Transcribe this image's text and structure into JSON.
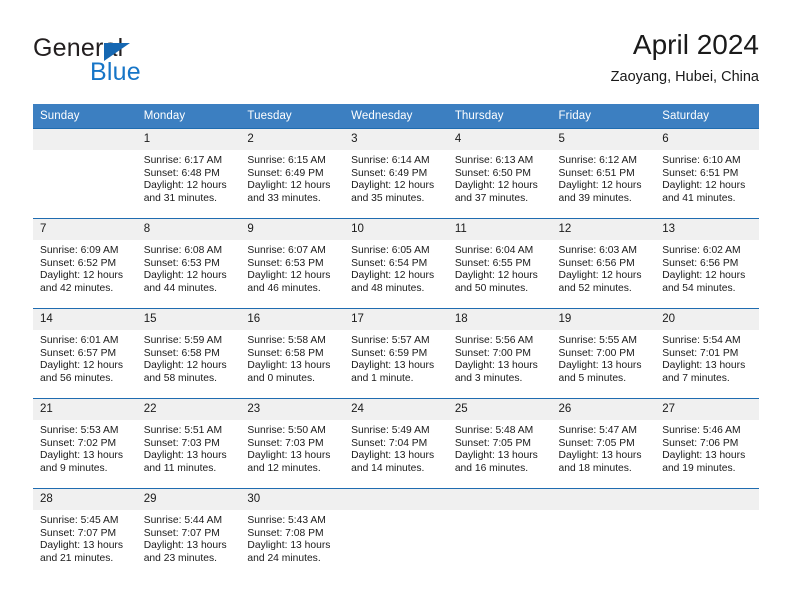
{
  "brand": {
    "name_part1": "General",
    "name_part2": "Blue",
    "accent_color": "#1675c7",
    "triangle_color": "#1567b2"
  },
  "header": {
    "title": "April 2024",
    "subtitle": "Zaoyang, Hubei, China",
    "header_bg": "#3c7fc1",
    "row_border": "#1f6cb0",
    "daynum_bg": "#f0f0f0"
  },
  "weekdays": [
    "Sunday",
    "Monday",
    "Tuesday",
    "Wednesday",
    "Thursday",
    "Friday",
    "Saturday"
  ],
  "weeks": [
    [
      {
        "day": "",
        "sunrise": "",
        "sunset": "",
        "daylight1": "",
        "daylight2": ""
      },
      {
        "day": "1",
        "sunrise": "Sunrise: 6:17 AM",
        "sunset": "Sunset: 6:48 PM",
        "daylight1": "Daylight: 12 hours",
        "daylight2": "and 31 minutes."
      },
      {
        "day": "2",
        "sunrise": "Sunrise: 6:15 AM",
        "sunset": "Sunset: 6:49 PM",
        "daylight1": "Daylight: 12 hours",
        "daylight2": "and 33 minutes."
      },
      {
        "day": "3",
        "sunrise": "Sunrise: 6:14 AM",
        "sunset": "Sunset: 6:49 PM",
        "daylight1": "Daylight: 12 hours",
        "daylight2": "and 35 minutes."
      },
      {
        "day": "4",
        "sunrise": "Sunrise: 6:13 AM",
        "sunset": "Sunset: 6:50 PM",
        "daylight1": "Daylight: 12 hours",
        "daylight2": "and 37 minutes."
      },
      {
        "day": "5",
        "sunrise": "Sunrise: 6:12 AM",
        "sunset": "Sunset: 6:51 PM",
        "daylight1": "Daylight: 12 hours",
        "daylight2": "and 39 minutes."
      },
      {
        "day": "6",
        "sunrise": "Sunrise: 6:10 AM",
        "sunset": "Sunset: 6:51 PM",
        "daylight1": "Daylight: 12 hours",
        "daylight2": "and 41 minutes."
      }
    ],
    [
      {
        "day": "7",
        "sunrise": "Sunrise: 6:09 AM",
        "sunset": "Sunset: 6:52 PM",
        "daylight1": "Daylight: 12 hours",
        "daylight2": "and 42 minutes."
      },
      {
        "day": "8",
        "sunrise": "Sunrise: 6:08 AM",
        "sunset": "Sunset: 6:53 PM",
        "daylight1": "Daylight: 12 hours",
        "daylight2": "and 44 minutes."
      },
      {
        "day": "9",
        "sunrise": "Sunrise: 6:07 AM",
        "sunset": "Sunset: 6:53 PM",
        "daylight1": "Daylight: 12 hours",
        "daylight2": "and 46 minutes."
      },
      {
        "day": "10",
        "sunrise": "Sunrise: 6:05 AM",
        "sunset": "Sunset: 6:54 PM",
        "daylight1": "Daylight: 12 hours",
        "daylight2": "and 48 minutes."
      },
      {
        "day": "11",
        "sunrise": "Sunrise: 6:04 AM",
        "sunset": "Sunset: 6:55 PM",
        "daylight1": "Daylight: 12 hours",
        "daylight2": "and 50 minutes."
      },
      {
        "day": "12",
        "sunrise": "Sunrise: 6:03 AM",
        "sunset": "Sunset: 6:56 PM",
        "daylight1": "Daylight: 12 hours",
        "daylight2": "and 52 minutes."
      },
      {
        "day": "13",
        "sunrise": "Sunrise: 6:02 AM",
        "sunset": "Sunset: 6:56 PM",
        "daylight1": "Daylight: 12 hours",
        "daylight2": "and 54 minutes."
      }
    ],
    [
      {
        "day": "14",
        "sunrise": "Sunrise: 6:01 AM",
        "sunset": "Sunset: 6:57 PM",
        "daylight1": "Daylight: 12 hours",
        "daylight2": "and 56 minutes."
      },
      {
        "day": "15",
        "sunrise": "Sunrise: 5:59 AM",
        "sunset": "Sunset: 6:58 PM",
        "daylight1": "Daylight: 12 hours",
        "daylight2": "and 58 minutes."
      },
      {
        "day": "16",
        "sunrise": "Sunrise: 5:58 AM",
        "sunset": "Sunset: 6:58 PM",
        "daylight1": "Daylight: 13 hours",
        "daylight2": "and 0 minutes."
      },
      {
        "day": "17",
        "sunrise": "Sunrise: 5:57 AM",
        "sunset": "Sunset: 6:59 PM",
        "daylight1": "Daylight: 13 hours",
        "daylight2": "and 1 minute."
      },
      {
        "day": "18",
        "sunrise": "Sunrise: 5:56 AM",
        "sunset": "Sunset: 7:00 PM",
        "daylight1": "Daylight: 13 hours",
        "daylight2": "and 3 minutes."
      },
      {
        "day": "19",
        "sunrise": "Sunrise: 5:55 AM",
        "sunset": "Sunset: 7:00 PM",
        "daylight1": "Daylight: 13 hours",
        "daylight2": "and 5 minutes."
      },
      {
        "day": "20",
        "sunrise": "Sunrise: 5:54 AM",
        "sunset": "Sunset: 7:01 PM",
        "daylight1": "Daylight: 13 hours",
        "daylight2": "and 7 minutes."
      }
    ],
    [
      {
        "day": "21",
        "sunrise": "Sunrise: 5:53 AM",
        "sunset": "Sunset: 7:02 PM",
        "daylight1": "Daylight: 13 hours",
        "daylight2": "and 9 minutes."
      },
      {
        "day": "22",
        "sunrise": "Sunrise: 5:51 AM",
        "sunset": "Sunset: 7:03 PM",
        "daylight1": "Daylight: 13 hours",
        "daylight2": "and 11 minutes."
      },
      {
        "day": "23",
        "sunrise": "Sunrise: 5:50 AM",
        "sunset": "Sunset: 7:03 PM",
        "daylight1": "Daylight: 13 hours",
        "daylight2": "and 12 minutes."
      },
      {
        "day": "24",
        "sunrise": "Sunrise: 5:49 AM",
        "sunset": "Sunset: 7:04 PM",
        "daylight1": "Daylight: 13 hours",
        "daylight2": "and 14 minutes."
      },
      {
        "day": "25",
        "sunrise": "Sunrise: 5:48 AM",
        "sunset": "Sunset: 7:05 PM",
        "daylight1": "Daylight: 13 hours",
        "daylight2": "and 16 minutes."
      },
      {
        "day": "26",
        "sunrise": "Sunrise: 5:47 AM",
        "sunset": "Sunset: 7:05 PM",
        "daylight1": "Daylight: 13 hours",
        "daylight2": "and 18 minutes."
      },
      {
        "day": "27",
        "sunrise": "Sunrise: 5:46 AM",
        "sunset": "Sunset: 7:06 PM",
        "daylight1": "Daylight: 13 hours",
        "daylight2": "and 19 minutes."
      }
    ],
    [
      {
        "day": "28",
        "sunrise": "Sunrise: 5:45 AM",
        "sunset": "Sunset: 7:07 PM",
        "daylight1": "Daylight: 13 hours",
        "daylight2": "and 21 minutes."
      },
      {
        "day": "29",
        "sunrise": "Sunrise: 5:44 AM",
        "sunset": "Sunset: 7:07 PM",
        "daylight1": "Daylight: 13 hours",
        "daylight2": "and 23 minutes."
      },
      {
        "day": "30",
        "sunrise": "Sunrise: 5:43 AM",
        "sunset": "Sunset: 7:08 PM",
        "daylight1": "Daylight: 13 hours",
        "daylight2": "and 24 minutes."
      },
      {
        "day": "",
        "sunrise": "",
        "sunset": "",
        "daylight1": "",
        "daylight2": ""
      },
      {
        "day": "",
        "sunrise": "",
        "sunset": "",
        "daylight1": "",
        "daylight2": ""
      },
      {
        "day": "",
        "sunrise": "",
        "sunset": "",
        "daylight1": "",
        "daylight2": ""
      },
      {
        "day": "",
        "sunrise": "",
        "sunset": "",
        "daylight1": "",
        "daylight2": ""
      }
    ]
  ]
}
